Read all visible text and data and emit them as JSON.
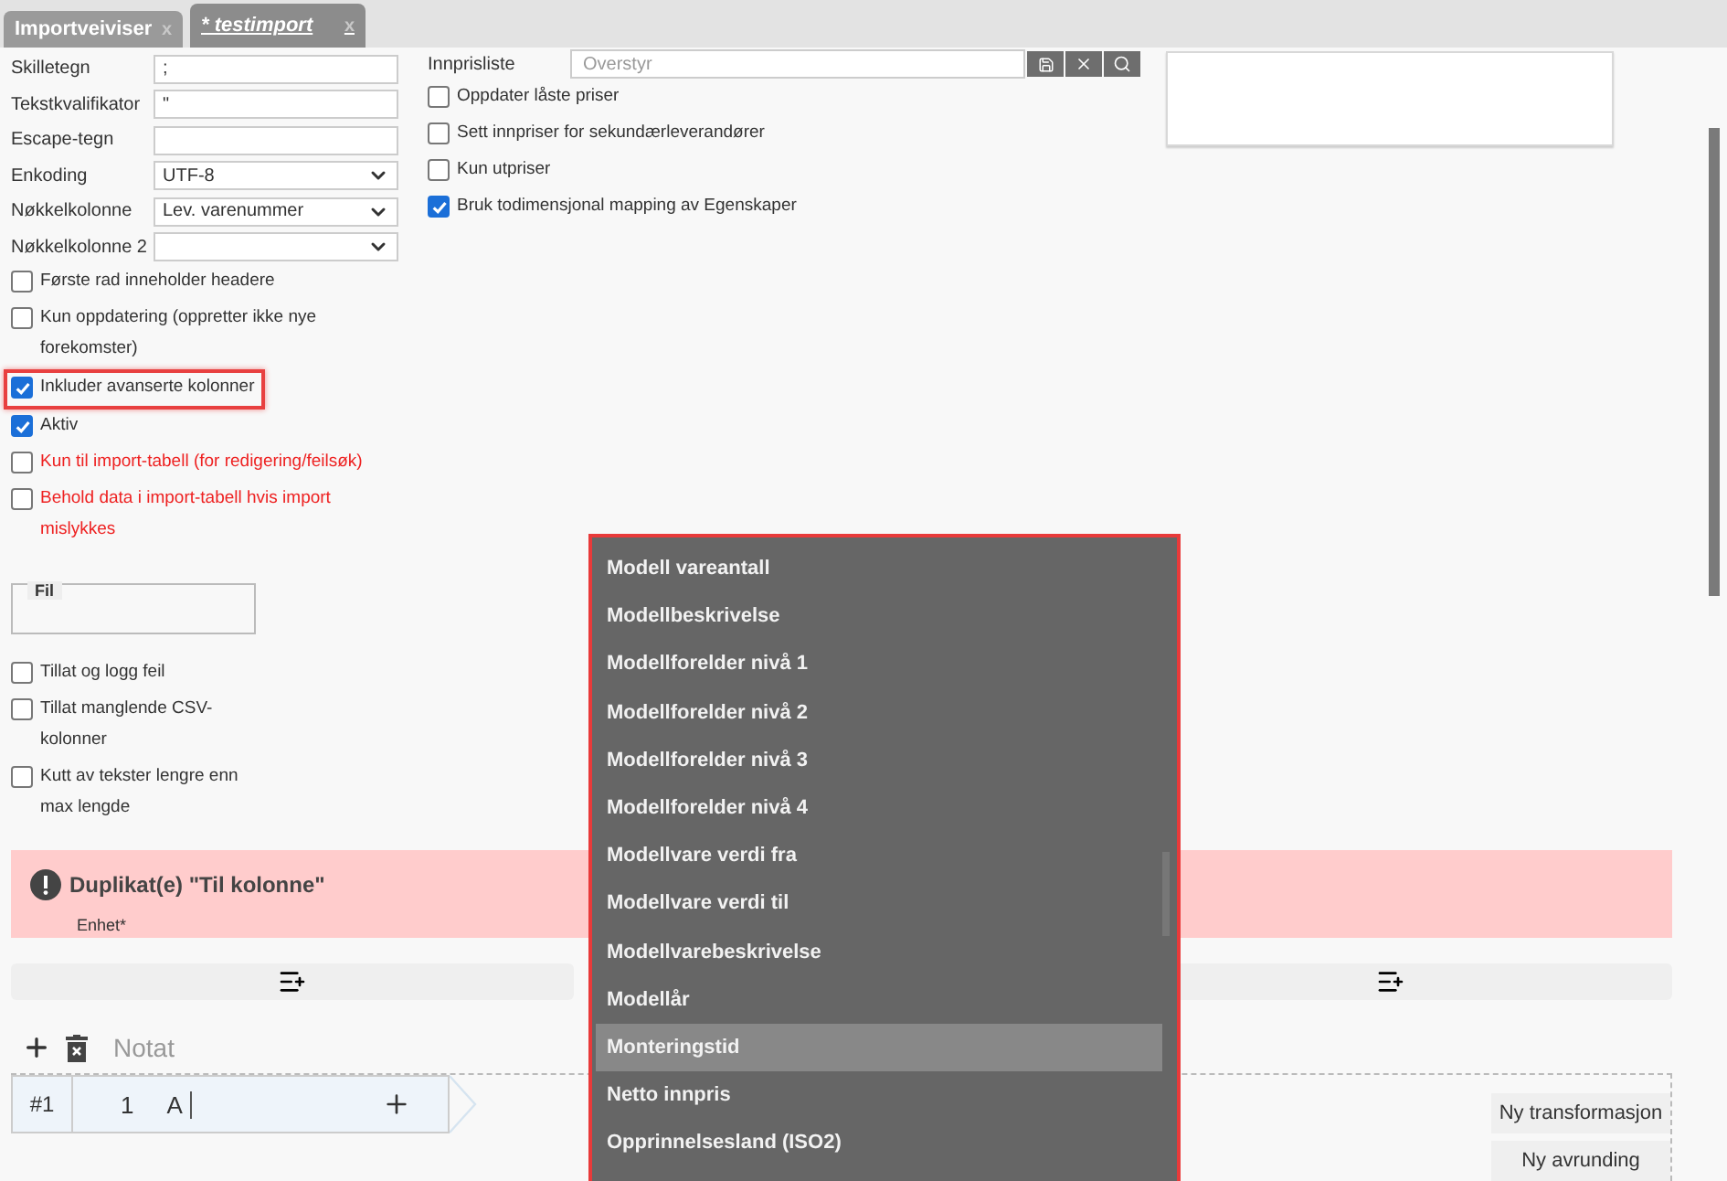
{
  "tabs": [
    {
      "label": "Importveiviser",
      "selected": false,
      "close": "x"
    },
    {
      "label": "* testimport",
      "selected": true,
      "close": "x"
    }
  ],
  "settings": {
    "fields": [
      {
        "label": "Skilletegn",
        "kind": "text",
        "value": ";"
      },
      {
        "label": "Tekstkvalifikator",
        "kind": "text",
        "value": "\""
      },
      {
        "label": "Escape-tegn",
        "kind": "text"
      },
      {
        "label": "Enkoding",
        "kind": "select",
        "value": "UTF-8"
      },
      {
        "label": "Nøkkelkolonne",
        "kind": "select",
        "value": "Lev. varenummer"
      },
      {
        "label": "Nøkkelkolonne 2",
        "kind": "select"
      }
    ],
    "options": [
      {
        "label": "Første rad inneholder headere",
        "checked": false,
        "warning": false,
        "highlighted": false
      },
      {
        "label": "Kun oppdatering (oppretter ikke nye forekomster)",
        "checked": false,
        "warning": false,
        "highlighted": false
      },
      {
        "label": "Inkluder avanserte kolonner",
        "checked": true,
        "warning": false,
        "highlighted": true
      },
      {
        "label": "Aktiv",
        "checked": true,
        "warning": false,
        "highlighted": false
      },
      {
        "label": "Kun til import-tabell (for redigering/feilsøk)",
        "checked": false,
        "warning": true,
        "highlighted": false
      },
      {
        "label": "Behold data i import-tabell hvis import mislykkes",
        "checked": false,
        "warning": true,
        "highlighted": false
      }
    ],
    "file_legend": "Fil",
    "error_options": [
      {
        "label": "Tillat og logg feil",
        "checked": false
      },
      {
        "label": "Tillat manglende CSV-kolonner",
        "checked": false
      },
      {
        "label": "Kutt av tekster lengre enn max lengde",
        "checked": false
      }
    ]
  },
  "prices": {
    "label": "Innprisliste",
    "placeholder": "Overstyr",
    "options": [
      {
        "label": "Oppdater låste priser",
        "checked": false
      },
      {
        "label": "Sett innpriser for sekundærleverandører",
        "checked": false
      },
      {
        "label": "Kun utpriser",
        "checked": false
      },
      {
        "label": "Bruk todimensjonal mapping av Egenskaper",
        "checked": true
      }
    ]
  },
  "alert": {
    "title": "Duplikat(e) \"Til kolonne\"",
    "detail": "Enhet*"
  },
  "notes": {
    "label": "Notat"
  },
  "mapping": {
    "index": "#1",
    "number": "1",
    "column": "A"
  },
  "buttons": [
    "Ny transformasjon",
    "Ny avrunding"
  ],
  "dropdown": {
    "highlighted": true,
    "items": [
      {
        "label": "Modell vareantall",
        "selected": false
      },
      {
        "label": "Modellbeskrivelse",
        "selected": false
      },
      {
        "label": "Modellforelder nivå 1",
        "selected": false
      },
      {
        "label": "Modellforelder nivå 2",
        "selected": false
      },
      {
        "label": "Modellforelder nivå 3",
        "selected": false
      },
      {
        "label": "Modellforelder nivå 4",
        "selected": false
      },
      {
        "label": "Modellvare verdi fra",
        "selected": false
      },
      {
        "label": "Modellvare verdi til",
        "selected": false
      },
      {
        "label": "Modellvarebeskrivelse",
        "selected": false
      },
      {
        "label": "Modellår",
        "selected": false
      },
      {
        "label": "Monteringstid",
        "selected": true
      },
      {
        "label": "Netto innpris",
        "selected": false
      },
      {
        "label": "Opprinnelsesland (ISO2)",
        "selected": false
      }
    ]
  }
}
